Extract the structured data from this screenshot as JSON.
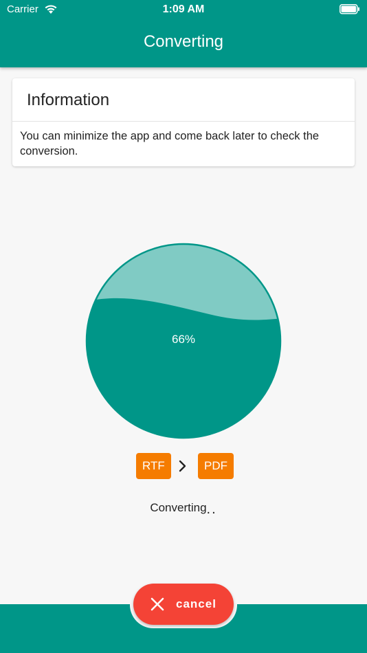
{
  "status_bar": {
    "carrier": "Carrier",
    "time": "1:09 AM"
  },
  "header": {
    "title": "Converting"
  },
  "info_card": {
    "title": "Information",
    "body": "You can minimize the app and come back later to check the conversion."
  },
  "progress": {
    "percent_label": "66%",
    "value": 0.66
  },
  "formats": {
    "from": "RTF",
    "to": "PDF"
  },
  "status": {
    "text": "Converting",
    "dots": ".."
  },
  "actions": {
    "cancel_label": "cancel"
  },
  "colors": {
    "primary": "#009688",
    "pie_light": "#80cbc4",
    "badge": "#f57c00",
    "cancel": "#f44336"
  }
}
